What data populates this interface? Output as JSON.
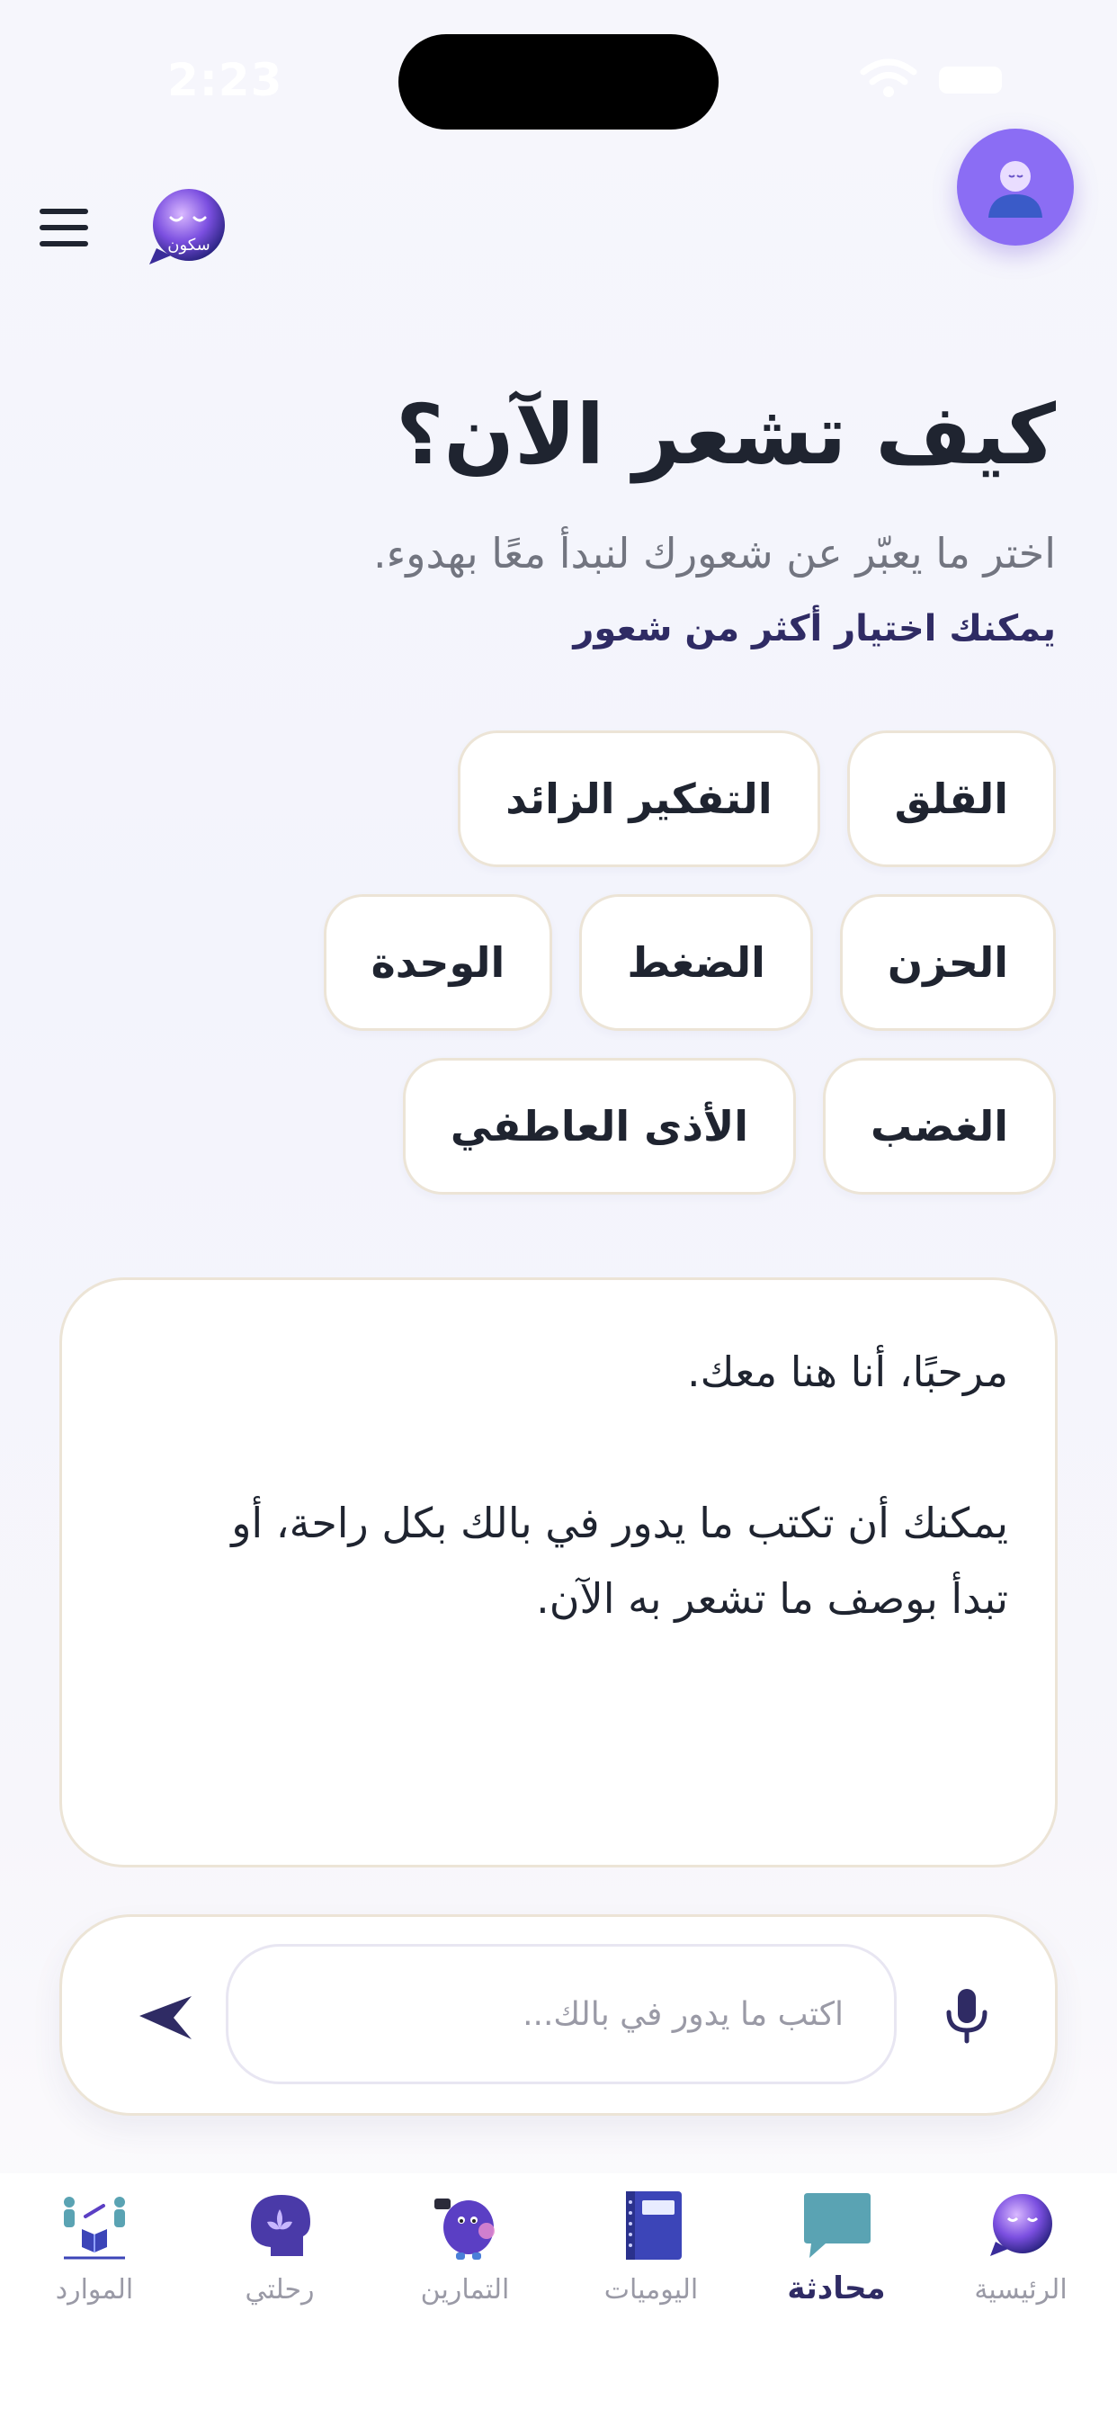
{
  "status_bar": {
    "time": "2:23"
  },
  "header": {
    "menu_icon": "hamburger-menu-icon",
    "logo_text": "سكون",
    "profile_icon": "user-avatar-icon"
  },
  "main": {
    "title": "كيف تشعر الآن؟",
    "subtitle": "اختر ما يعبّر عن شعورك لنبدأ معًا بهدوء.",
    "multi_select_hint": "يمكنك اختيار أكثر من شعور",
    "moods": [
      "القلق",
      "التفكير الزائد",
      "الحزن",
      "الضغط",
      "الوحدة",
      "الغضب",
      "الأذى العاطفي"
    ]
  },
  "message": {
    "greeting": "مرحبًا، أنا هنا معك.",
    "body_line1": "يمكنك أن تكتب ما يدور في بالك بكل راحة، أو",
    "body_line2": "تبدأ بوصف ما تشعر به الآن."
  },
  "composer": {
    "placeholder": "اكتب ما يدور في بالك...",
    "mic_icon": "microphone-icon",
    "send_icon": "send-icon"
  },
  "bottom_nav": {
    "items": [
      {
        "label": "الرئيسية",
        "icon": "home-logo-icon"
      },
      {
        "label": "محادثة",
        "icon": "chat-bubble-icon",
        "active": true
      },
      {
        "label": "اليوميات",
        "icon": "journal-notebook-icon"
      },
      {
        "label": "التمارين",
        "icon": "exercises-mascot-icon"
      },
      {
        "label": "رحلتي",
        "icon": "mind-lotus-icon"
      },
      {
        "label": "الموارد",
        "icon": "resources-people-icon"
      }
    ]
  },
  "colors": {
    "accent": "#8b6df4",
    "dark_purple": "#2f2b64",
    "chip_border": "#ece4d6",
    "text": "#1f2430",
    "muted": "#727580"
  }
}
